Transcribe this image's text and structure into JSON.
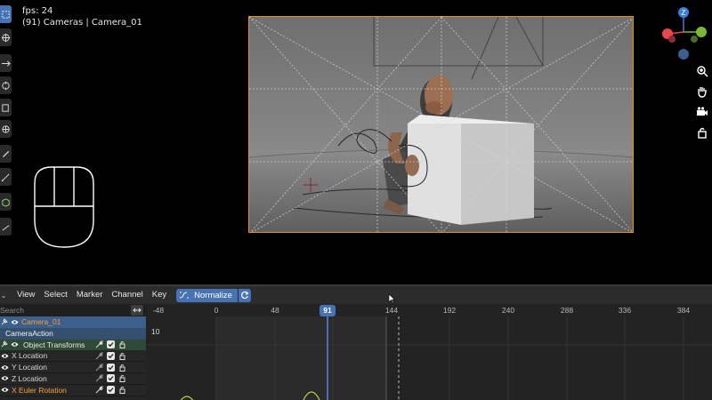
{
  "viewport": {
    "fps_text": "fps: 24",
    "camera_text": "(91) Cameras | Camera_01",
    "gizmo_axis": "Z",
    "colors": {
      "camera_border": "#e58a2a",
      "gizmo_x": "#e5484d",
      "gizmo_y": "#7ab833",
      "gizmo_z": "#3b7fe0"
    },
    "nav_icons": [
      "zoom-icon",
      "hand-pan-icon",
      "camera-view-icon",
      "lock-icon"
    ]
  },
  "editor": {
    "menu": [
      "View",
      "Select",
      "Marker",
      "Channel",
      "Key"
    ],
    "normalize_label": "Normalize",
    "search_placeholder": "Search",
    "channels": [
      {
        "label": "Camera_01",
        "kind": "object"
      },
      {
        "label": "CameraAction",
        "kind": "action"
      },
      {
        "label": "Object Transforms",
        "kind": "group"
      },
      {
        "label": "X Location",
        "kind": "fcurve"
      },
      {
        "label": "Y Location",
        "kind": "fcurve"
      },
      {
        "label": "Z Location",
        "kind": "fcurve"
      },
      {
        "label": "X Euler Rotation",
        "kind": "fcurve"
      }
    ],
    "timeline": {
      "ticks": [
        "-48",
        "0",
        "48",
        "91",
        "144",
        "192",
        "240",
        "288",
        "336",
        "384"
      ],
      "current_frame": "91",
      "y_value_label": "10",
      "colors": {
        "accent": "#4772b3",
        "curve": "#b7d23a"
      }
    }
  }
}
